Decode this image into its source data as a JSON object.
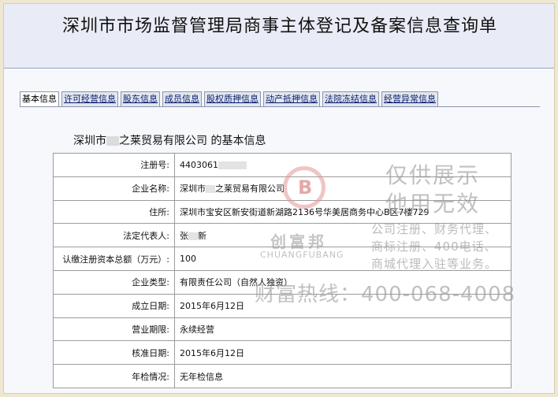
{
  "header": {
    "title": "深圳市市场监督管理局商事主体登记及备案信息查询单"
  },
  "tabs": [
    {
      "label": "基本信息",
      "active": true
    },
    {
      "label": "许可经营信息",
      "active": false
    },
    {
      "label": "股东信息",
      "active": false
    },
    {
      "label": "成员信息",
      "active": false
    },
    {
      "label": "股权质押信息",
      "active": false
    },
    {
      "label": "动产抵押信息",
      "active": false
    },
    {
      "label": "法院冻结信息",
      "active": false
    },
    {
      "label": "经营异常信息",
      "active": false
    }
  ],
  "company_heading": {
    "prefix": "深圳市",
    "suffix": "之莱贸易有限公司  的基本信息"
  },
  "info_rows": [
    {
      "label": "注册号:",
      "value": "4403061"
    },
    {
      "label": "企业名称:",
      "value": "深圳市",
      "value2": "之莱贸易有限公司"
    },
    {
      "label": "住所:",
      "value": "深圳市宝安区新安街道新湖路2136号华美居商务中心B区7楼729"
    },
    {
      "label": "法定代表人:",
      "value": "张",
      "value2": "新"
    },
    {
      "label": "认缴注册资本总额（万元）:",
      "value": "100"
    },
    {
      "label": "企业类型:",
      "value": "有限责任公司（自然人独资）"
    },
    {
      "label": "成立日期:",
      "value": "2015年6月12日"
    },
    {
      "label": "营业期限:",
      "value": "永续经营"
    },
    {
      "label": "核准日期:",
      "value": "2015年6月12日"
    },
    {
      "label": "年检情况:",
      "value": "无年检信息"
    }
  ],
  "watermark": {
    "logo_letter": "B",
    "brand_cn": "创富邦",
    "brand_en": "CHUANGFUBANG",
    "line1": "仅供展示",
    "line2": "他用无效",
    "svc1": "公司注册、财务代理、",
    "svc2": "商标注册、400电话、",
    "svc3": "商城代理入驻等业务。",
    "hotline": "财富热线：400-068-4008"
  }
}
